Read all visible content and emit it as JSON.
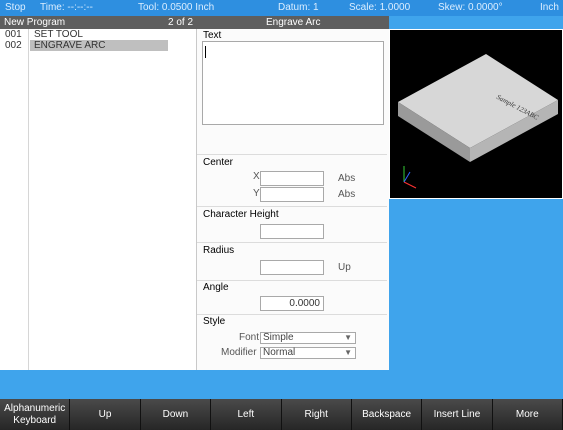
{
  "status": {
    "mode": "Stop",
    "time": "Time: --:--:--",
    "tool": "Tool: 0.0500 Inch",
    "datum": "Datum: 1",
    "scale": "Scale: 1.0000",
    "skew": "Skew: 0.0000°",
    "units": "Inch"
  },
  "program": {
    "name": "New Program",
    "position": "2 of 2",
    "step": "Engrave Arc",
    "steps": [
      {
        "num": "001",
        "label": "SET TOOL"
      },
      {
        "num": "002",
        "label": "ENGRAVE ARC"
      }
    ]
  },
  "form": {
    "text_label": "Text",
    "text_value": "",
    "center_label": "Center",
    "x_label": "X",
    "y_label": "Y",
    "x_value": "",
    "y_value": "",
    "x_mode": "Abs",
    "y_mode": "Abs",
    "char_height_label": "Character Height",
    "char_height_value": "",
    "radius_label": "Radius",
    "radius_value": "",
    "radius_dir": "Up",
    "angle_label": "Angle",
    "angle_value": "0.0000",
    "style_label": "Style",
    "font_label": "Font",
    "font_value": "Simple",
    "modifier_label": "Modifier",
    "modifier_value": "Normal"
  },
  "preview": {
    "engraved_text": "Sample 123ABC"
  },
  "softkeys": [
    "Alphanumeric Keyboard",
    "Up",
    "Down",
    "Left",
    "Right",
    "Backspace",
    "Insert Line",
    "More"
  ]
}
